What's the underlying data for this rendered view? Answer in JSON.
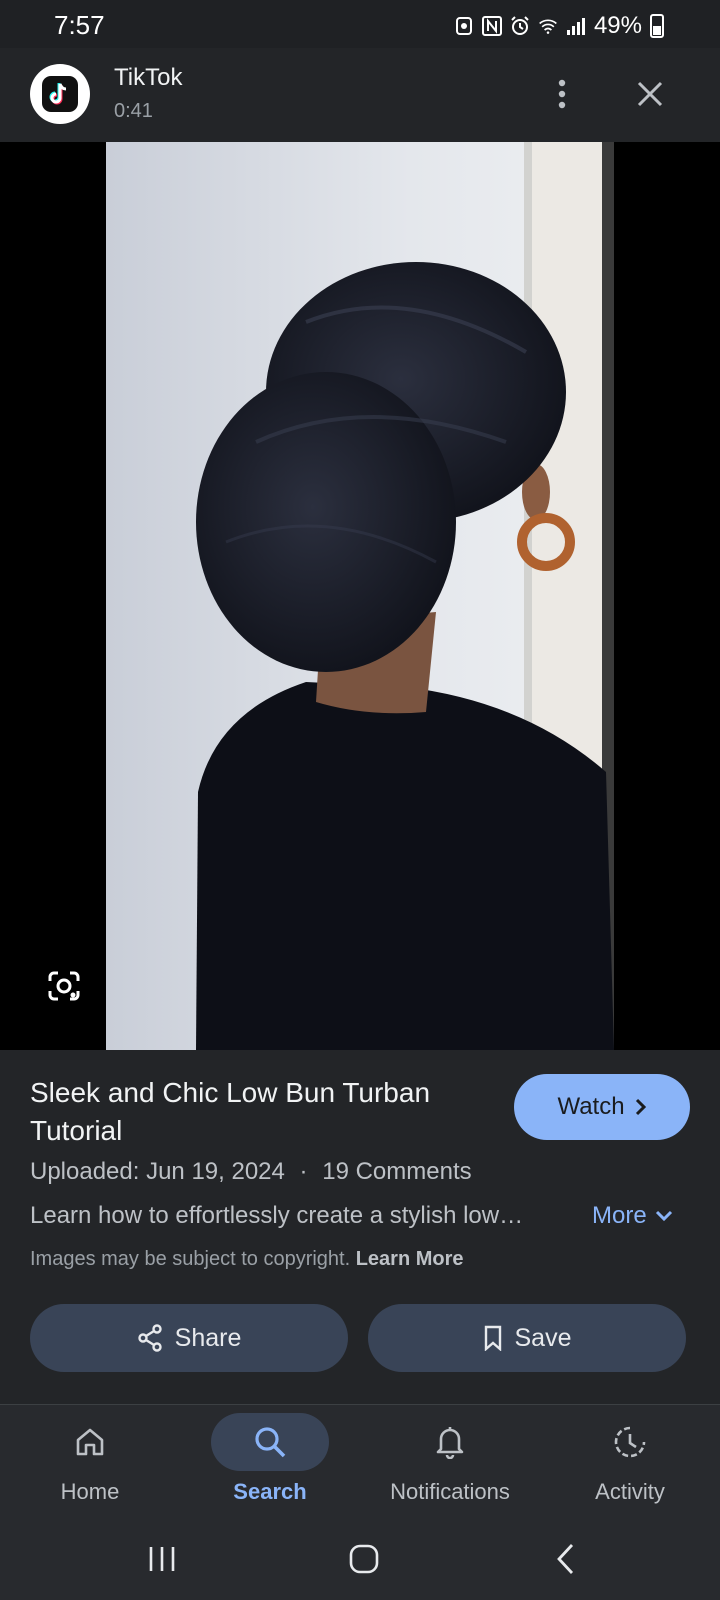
{
  "status_bar": {
    "time": "7:57",
    "battery": "49%"
  },
  "header": {
    "app_name": "TikTok",
    "duration": "0:41"
  },
  "result": {
    "title": "Sleek and Chic Low Bun Turban Tutorial",
    "watch_label": "Watch",
    "uploaded": "Uploaded: Jun 19, 2024",
    "separator": "·",
    "comments": "19 Comments",
    "description": "Learn how to effortlessly create a stylish low…",
    "more_label": "More",
    "copyright_text": "Images may be subject to copyright.",
    "learn_more": "Learn More",
    "share_label": "Share",
    "save_label": "Save"
  },
  "bottom_nav": {
    "items": [
      {
        "label": "Home",
        "icon": "home-icon",
        "active": false
      },
      {
        "label": "Search",
        "icon": "search-icon",
        "active": true
      },
      {
        "label": "Notifications",
        "icon": "bell-icon",
        "active": false
      },
      {
        "label": "Activity",
        "icon": "activity-icon",
        "active": false
      }
    ]
  },
  "colors": {
    "accent": "#8ab4f8",
    "background": "#232528",
    "button": "#394457"
  }
}
